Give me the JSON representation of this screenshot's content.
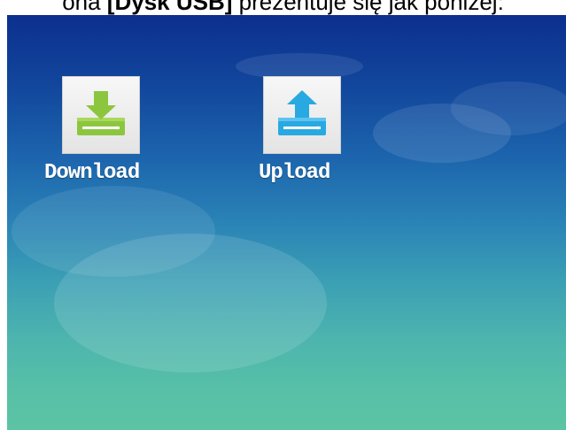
{
  "caption": {
    "prefix": "ona ",
    "highlight": "[Dysk USB]",
    "suffix": " prezentuje się jak poniżej:"
  },
  "apps": {
    "download": {
      "label": "Download",
      "icon": "download-tray-icon",
      "color": "#8cc63f"
    },
    "upload": {
      "label": "Upload",
      "icon": "upload-tray-icon",
      "color": "#29a9e1"
    }
  },
  "colors": {
    "background_top": "#0c2f8e",
    "background_bottom": "#5cc4a4",
    "label": "#ffffff"
  }
}
